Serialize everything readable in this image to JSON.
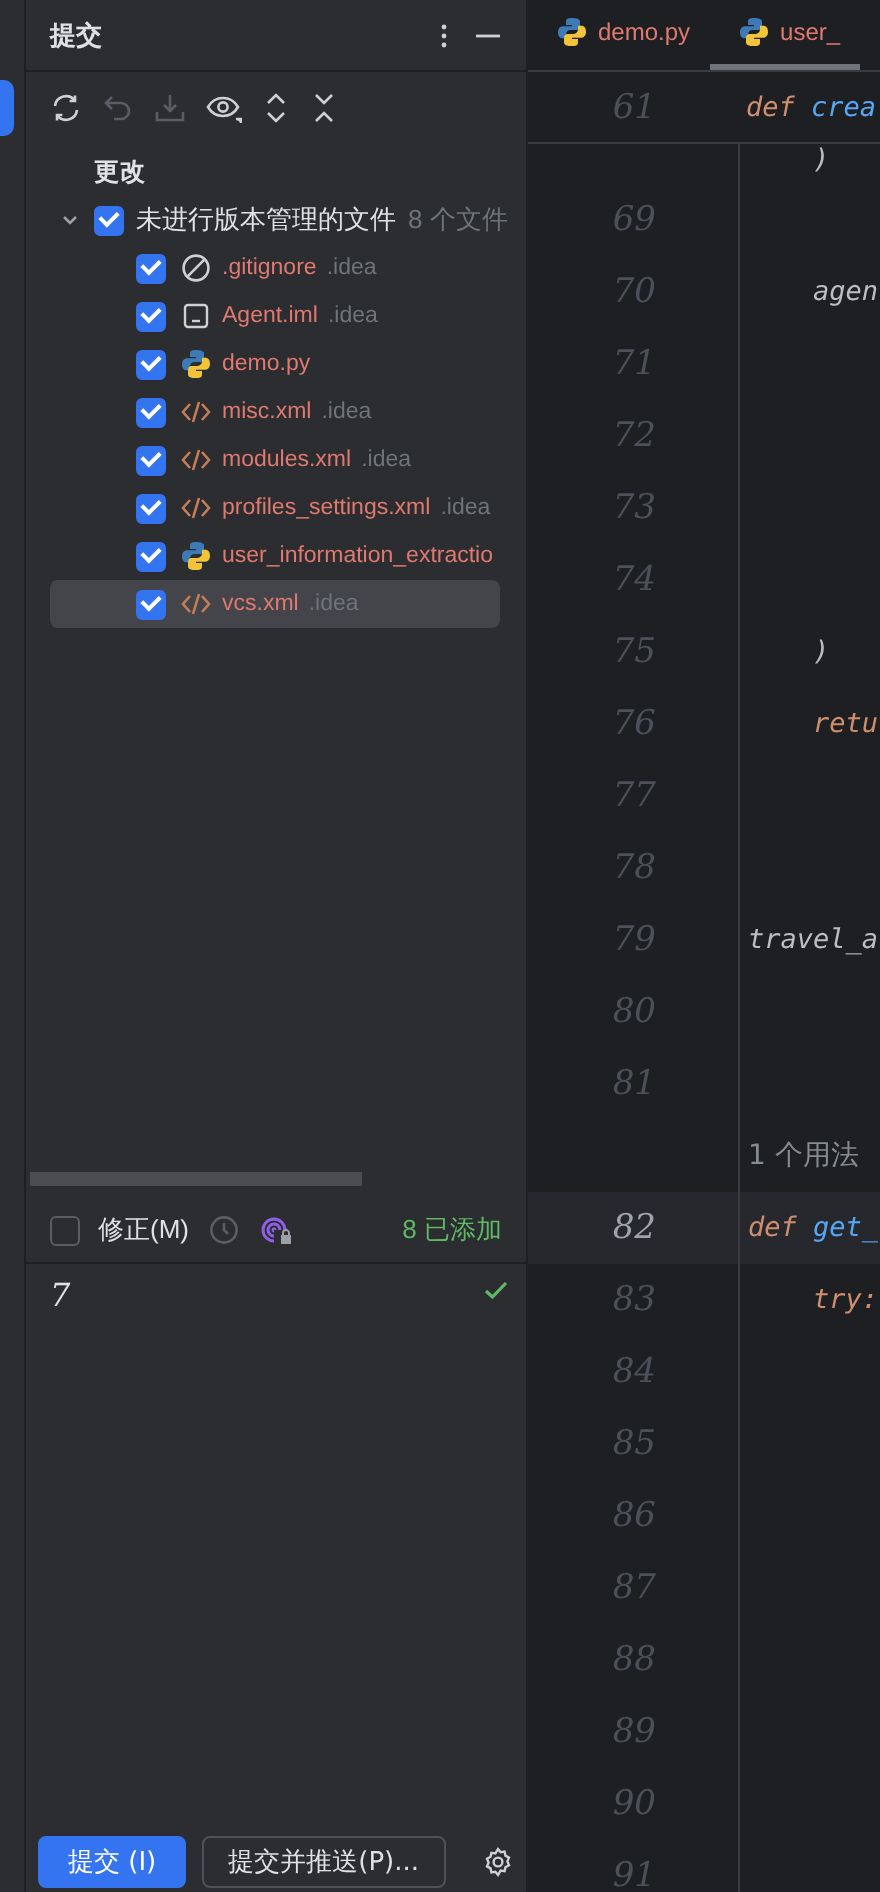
{
  "commit_panel": {
    "title": "提交",
    "section_label": "更改",
    "group": {
      "label": "未进行版本管理的文件",
      "count": "8 个文件",
      "expanded": true,
      "checked": true
    },
    "files": [
      {
        "name": ".gitignore",
        "dir": ".idea",
        "kind": "ignore",
        "checked": true,
        "selected": false
      },
      {
        "name": "Agent.iml",
        "dir": ".idea",
        "kind": "module",
        "checked": true,
        "selected": false
      },
      {
        "name": "demo.py",
        "kind": "python",
        "checked": true,
        "selected": false
      },
      {
        "name": "misc.xml",
        "dir": ".idea",
        "kind": "xml",
        "checked": true,
        "selected": false
      },
      {
        "name": "modules.xml",
        "dir": ".idea",
        "kind": "xml",
        "checked": true,
        "selected": false
      },
      {
        "name": "profiles_settings.xml",
        "dir": ".idea",
        "kind": "xml",
        "checked": true,
        "selected": false
      },
      {
        "name": "user_information_extractio",
        "kind": "python",
        "checked": true,
        "selected": false
      },
      {
        "name": "vcs.xml",
        "dir": ".idea",
        "kind": "xml",
        "checked": true,
        "selected": true
      }
    ],
    "amend": {
      "label": "修正(M)",
      "checked": false
    },
    "added": "8 已添加",
    "message": {
      "value": "7"
    },
    "commit_button": "提交 (I)",
    "commit_push_button": "提交并推送(P)..."
  },
  "editor": {
    "tabs": [
      {
        "label": "demo.py",
        "selected": false
      },
      {
        "label": "user_",
        "selected": true
      }
    ],
    "sticky": {
      "number": "61",
      "tokens": [
        {
          "text": "def ",
          "kind": "keyword"
        },
        {
          "text": "crea",
          "kind": "function"
        }
      ]
    },
    "lines": [
      {
        "tokens": [
          {
            "text": "    )",
            "kind": "plain"
          }
        ],
        "kind": "partial"
      },
      {
        "number": "69",
        "kind": "code"
      },
      {
        "number": "70",
        "tokens": [
          {
            "text": "    agen",
            "kind": "plain"
          }
        ],
        "kind": "code"
      },
      {
        "number": "71",
        "kind": "code"
      },
      {
        "number": "72",
        "kind": "code"
      },
      {
        "number": "73",
        "kind": "code"
      },
      {
        "number": "74",
        "kind": "code"
      },
      {
        "number": "75",
        "tokens": [
          {
            "text": "    )",
            "kind": "plain"
          }
        ],
        "kind": "code"
      },
      {
        "number": "76",
        "tokens": [
          {
            "text": "    retu",
            "kind": "keyword"
          }
        ],
        "kind": "code"
      },
      {
        "number": "77",
        "kind": "code"
      },
      {
        "number": "78",
        "kind": "code"
      },
      {
        "number": "79",
        "tokens": [
          {
            "text": "travel_a",
            "kind": "plain"
          }
        ],
        "kind": "code"
      },
      {
        "number": "80",
        "kind": "code"
      },
      {
        "number": "81",
        "kind": "code"
      },
      {
        "tokens": [
          {
            "text": "1 个用法",
            "kind": "plain"
          }
        ],
        "kind": "inlay"
      },
      {
        "number": "82",
        "tokens": [
          {
            "text": "def ",
            "kind": "keyword"
          },
          {
            "text": "get_",
            "kind": "function"
          }
        ],
        "kind": "current"
      },
      {
        "number": "83",
        "tokens": [
          {
            "text": "    try:",
            "kind": "keyword"
          }
        ],
        "kind": "code"
      },
      {
        "number": "84",
        "kind": "code"
      },
      {
        "number": "85",
        "kind": "code"
      },
      {
        "number": "86",
        "kind": "code"
      },
      {
        "number": "87",
        "kind": "code"
      },
      {
        "number": "88",
        "kind": "code"
      },
      {
        "number": "89",
        "kind": "code"
      },
      {
        "number": "90",
        "kind": "code"
      },
      {
        "number": "91",
        "kind": "code"
      }
    ]
  }
}
